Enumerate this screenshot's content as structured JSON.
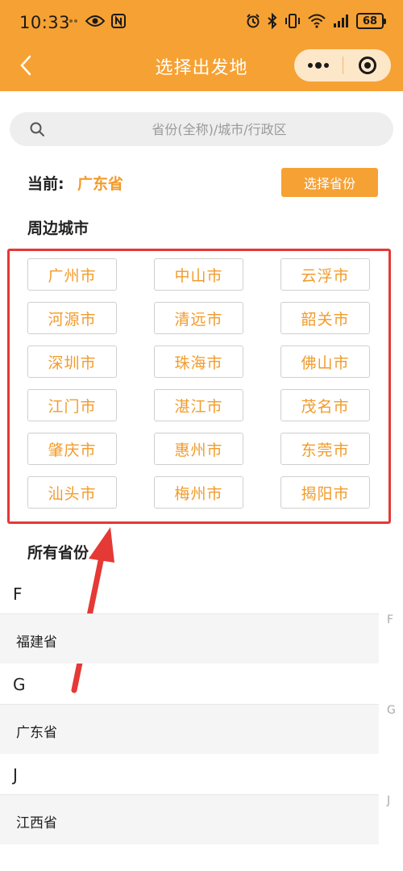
{
  "status_bar": {
    "time": "10:33",
    "battery": "68",
    "left_icons": [
      "notification-dots-icon",
      "eye-icon",
      "nfc-icon"
    ],
    "right_icons": [
      "alarm-icon",
      "bluetooth-icon",
      "vibrate-icon",
      "wifi-icon",
      "signal-icon"
    ]
  },
  "nav": {
    "title": "选择出发地",
    "back_icon": "chevron-left-icon",
    "more_icon": "more-dots-icon",
    "close_icon": "target-close-icon"
  },
  "search": {
    "placeholder": "省份(全称)/城市/行政区",
    "value": ""
  },
  "current": {
    "label": "当前:",
    "value": "广东省",
    "select_button": "选择省份"
  },
  "nearby": {
    "title": "周边城市",
    "cities": [
      "广州市",
      "中山市",
      "云浮市",
      "河源市",
      "清远市",
      "韶关市",
      "深圳市",
      "珠海市",
      "佛山市",
      "江门市",
      "湛江市",
      "茂名市",
      "肇庆市",
      "惠州市",
      "东莞市",
      "汕头市",
      "梅州市",
      "揭阳市"
    ]
  },
  "provinces": {
    "title": "所有省份",
    "groups": [
      {
        "letter": "F",
        "items": [
          "福建省"
        ]
      },
      {
        "letter": "G",
        "items": [
          "广东省"
        ]
      },
      {
        "letter": "J",
        "items": [
          "江西省"
        ]
      }
    ],
    "index": [
      "F",
      "G",
      "J"
    ]
  },
  "colors": {
    "accent": "#f6a133",
    "city_text": "#f29b2a",
    "highlight": "#e53935"
  }
}
